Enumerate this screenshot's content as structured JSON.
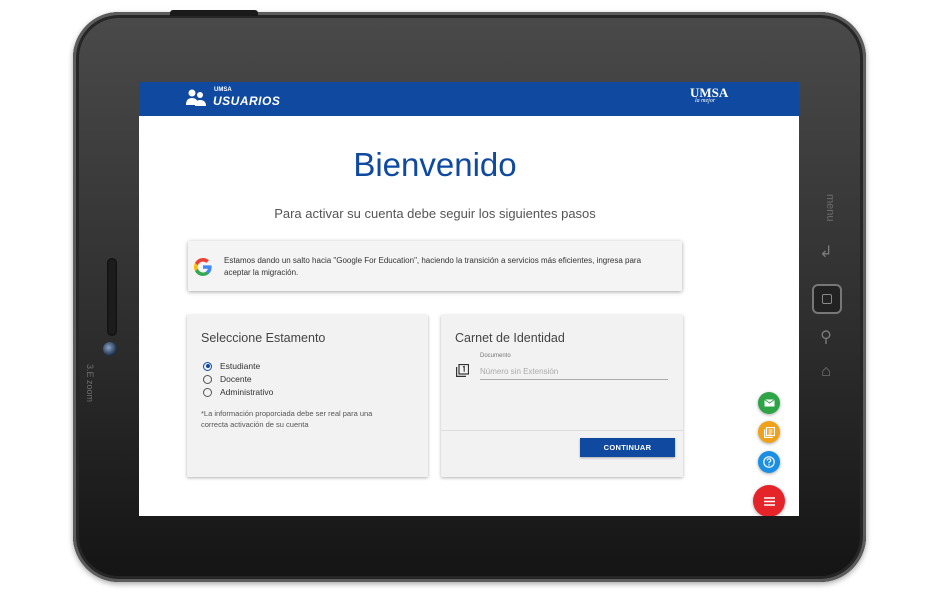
{
  "device": {
    "brand_label": "3.E zoom",
    "side_label": "menu"
  },
  "header": {
    "logo_small": "UMSA",
    "logo_text": "USUARIOS",
    "institution": "UMSA",
    "institution_sub": "la mejor"
  },
  "main": {
    "title": "Bienvenido",
    "subtitle": "Para activar su cuenta debe seguir los siguientes pasos"
  },
  "notice": {
    "icon": "google-g-icon",
    "text": "Estamos dando un salto hacia \"Google For Education\", haciendo la transición a servicios más eficientes, ingresa para aceptar la migración."
  },
  "estamento": {
    "title": "Seleccione Estamento",
    "options": [
      {
        "label": "Estudiante",
        "selected": true
      },
      {
        "label": "Docente",
        "selected": false
      },
      {
        "label": "Administrativo",
        "selected": false
      }
    ],
    "note": "*La información proporciada debe ser real para una correcta activación de su cuenta"
  },
  "carnet": {
    "title": "Carnet de Identidad",
    "field_label": "Documento",
    "field_placeholder": "Número sin Extensión",
    "field_value": "",
    "button_label": "CONTINUAR"
  },
  "fabs": [
    {
      "name": "mail",
      "color": "#2ea447"
    },
    {
      "name": "book",
      "color": "#f0a11a"
    },
    {
      "name": "help",
      "color": "#1a8fe3"
    },
    {
      "name": "menu",
      "color": "#e5242a"
    }
  ],
  "colors": {
    "primary": "#0f4aa0",
    "accent": "#e5242a"
  }
}
